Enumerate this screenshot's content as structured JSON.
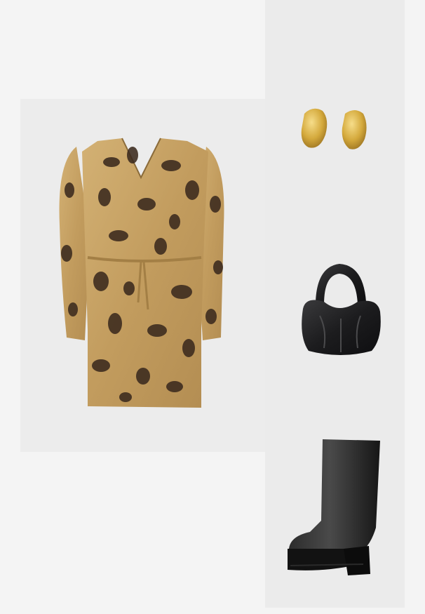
{
  "outfit": {
    "items": [
      {
        "name": "dress",
        "description_icon": "dress-icon",
        "colors": {
          "base": "#c9a56a",
          "print": "#3b2a1e"
        }
      },
      {
        "name": "earrings",
        "description_icon": "earrings-icon",
        "colors": {
          "metal": "#d4a93c"
        }
      },
      {
        "name": "handbag",
        "description_icon": "handbag-icon",
        "colors": {
          "leather": "#1c1c1e"
        }
      },
      {
        "name": "boot",
        "description_icon": "boot-icon",
        "colors": {
          "leather": "#1e1e1e"
        }
      }
    ],
    "background_colors": {
      "page": "#f4f4f4",
      "panel": "#ebebeb"
    }
  }
}
